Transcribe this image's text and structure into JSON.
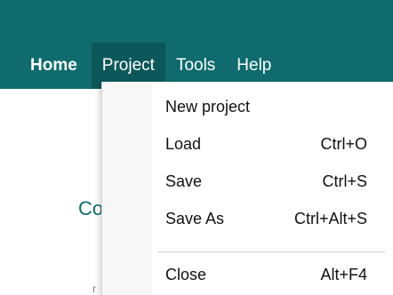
{
  "menubar": {
    "items": [
      {
        "label": "Home"
      },
      {
        "label": "Project"
      },
      {
        "label": "Tools"
      },
      {
        "label": "Help"
      }
    ]
  },
  "page": {
    "partial_text": "Co",
    "partial_text2": "r"
  },
  "dropdown": {
    "items": [
      {
        "label": "New project",
        "shortcut": ""
      },
      {
        "label": "Load",
        "shortcut": "Ctrl+O"
      },
      {
        "label": "Save",
        "shortcut": "Ctrl+S"
      },
      {
        "label": "Save As",
        "shortcut": "Ctrl+Alt+S"
      },
      {
        "label": "Close",
        "shortcut": "Alt+F4"
      }
    ]
  },
  "colors": {
    "header_bg": "#0f6b6d",
    "active_menu_bg": "#0b5759",
    "accent_text": "#0f6b6d"
  }
}
